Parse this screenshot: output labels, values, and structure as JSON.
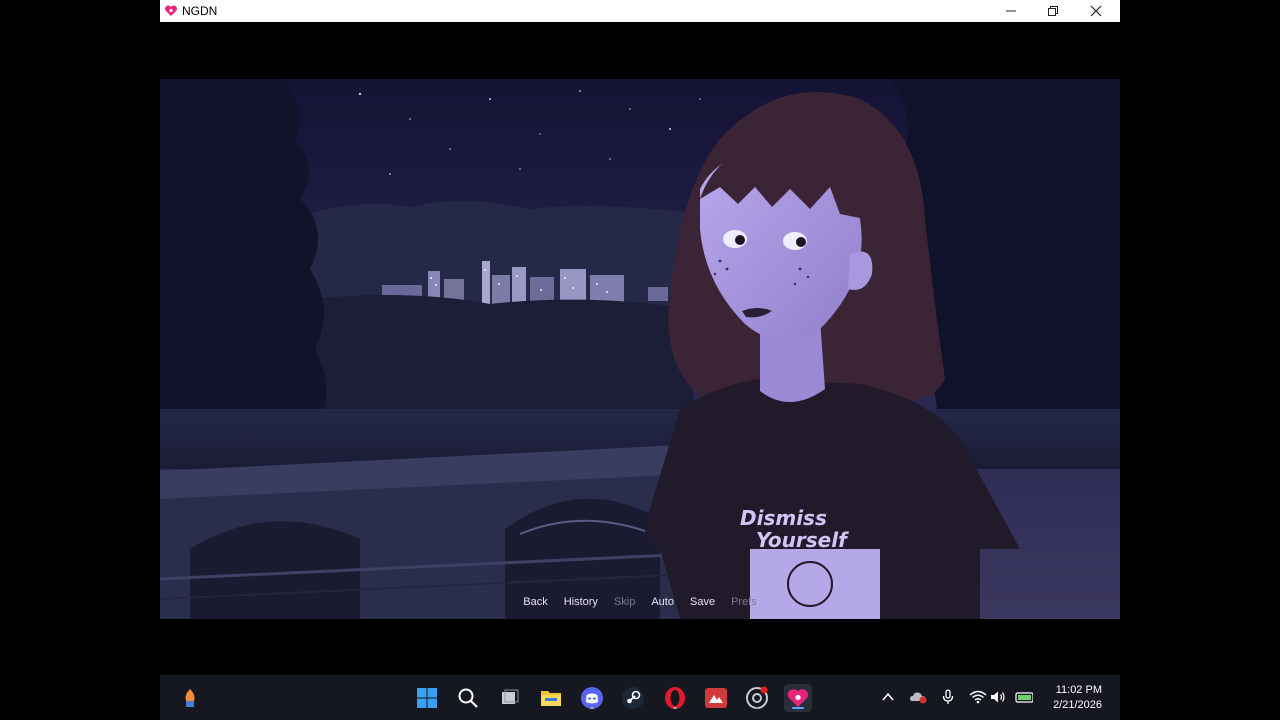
{
  "window": {
    "title": "NGDN",
    "controls": [
      "minimize",
      "restore",
      "close"
    ]
  },
  "game": {
    "scene": {
      "shirt_text_line1": "Dismiss",
      "shirt_text_line2": "Yourself"
    },
    "quick_menu": {
      "back": "Back",
      "history": "History",
      "skip": "Skip",
      "auto": "Auto",
      "save": "Save",
      "prefs": "Prefs"
    }
  },
  "taskbar": {
    "left_icon": "widgets-icon",
    "apps": [
      "windows-start-icon",
      "search-icon",
      "task-view-icon",
      "file-explorer-icon",
      "discord-icon",
      "steam-icon",
      "opera-icon",
      "app-red-icon",
      "chrome-icon",
      "ngdn-heart-icon"
    ],
    "tray": [
      "chevron-up-icon",
      "onedrive-icon",
      "microphone-icon",
      "wifi-icon",
      "volume-icon",
      "battery-icon"
    ],
    "time": "11:02 PM",
    "date": "2/21/2026"
  },
  "colors": {
    "accent_heart": "#e8237b",
    "menu_text": "#e6e4f2",
    "menu_disabled": "#7c7a8e"
  }
}
